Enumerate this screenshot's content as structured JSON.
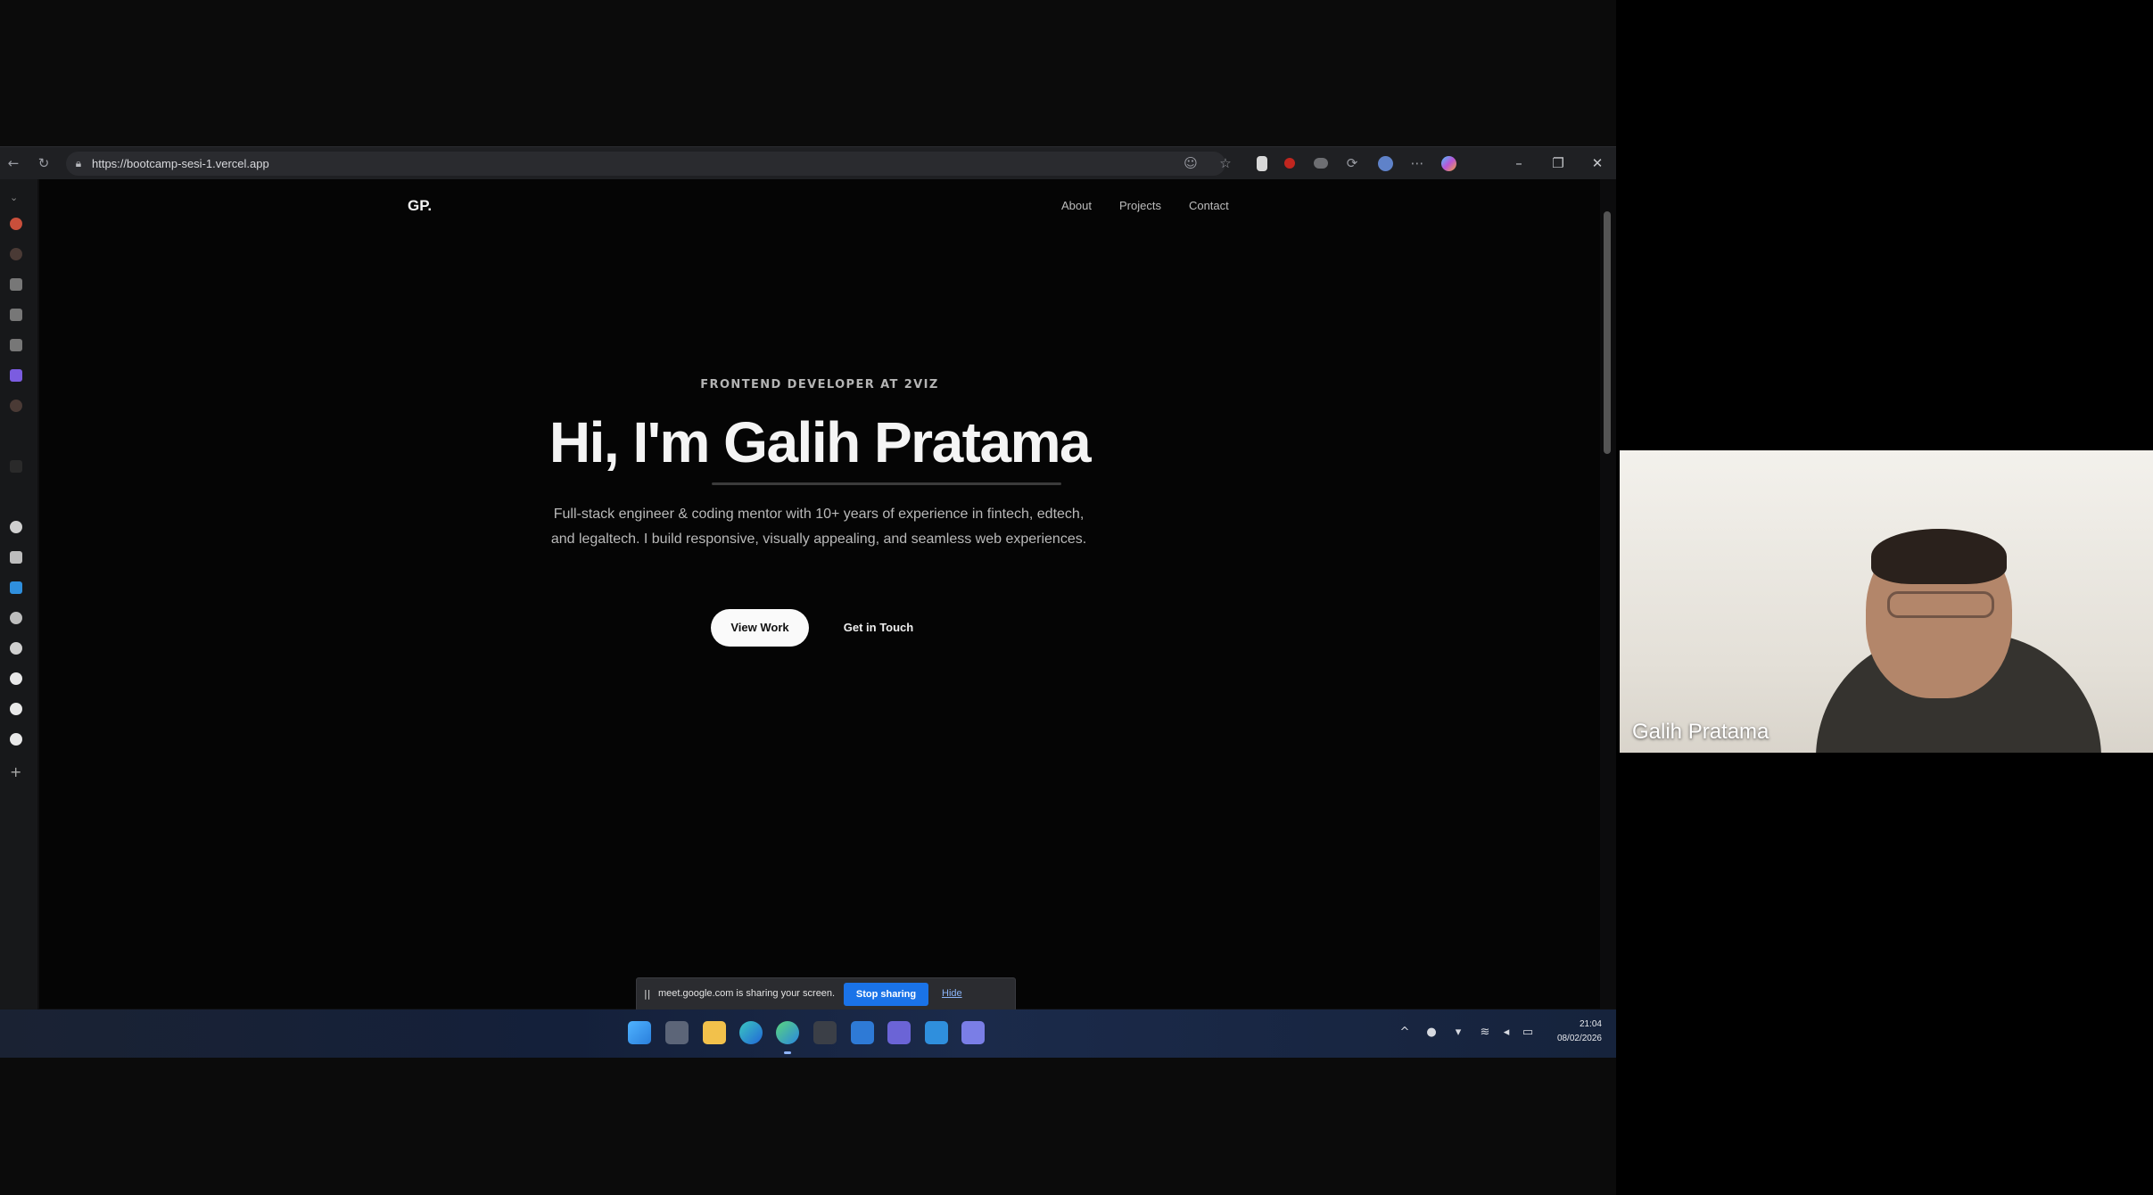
{
  "browser": {
    "url": "https://bootcamp-sesi-1.vercel.app",
    "icons": [
      "back-icon",
      "refresh-icon",
      "lock-icon",
      "reader-icon",
      "favorite-icon",
      "extension-icon",
      "profile-icon",
      "more-icon",
      "copilot-icon"
    ],
    "window_controls": [
      "minimize-icon",
      "restore-icon",
      "close-icon"
    ]
  },
  "site": {
    "logo": "GP.",
    "nav": [
      "About",
      "Projects",
      "Contact"
    ],
    "eyebrow": "FRONTEND DEVELOPER AT 2VIZ",
    "title": "Hi, I'm Galih Pratama",
    "description": "Full-stack engineer & coding mentor with 10+ years of experience in fintech, edtech, and legaltech. I build responsive, visually appealing, and seamless web experiences.",
    "buttons": {
      "primary": "View Work",
      "secondary": "Get in Touch"
    }
  },
  "share_bar": {
    "pause": "||",
    "message": "meet.google.com is sharing your screen.",
    "stop": "Stop sharing",
    "hide": "Hide"
  },
  "taskbar": {
    "time": "21:04",
    "date": "08/02/2026"
  },
  "participant": {
    "name": "Galih Pratama"
  },
  "colors": {
    "share_button": "#1a73e8",
    "hide_link": "#8ab4f8",
    "page_background": "#050505"
  }
}
